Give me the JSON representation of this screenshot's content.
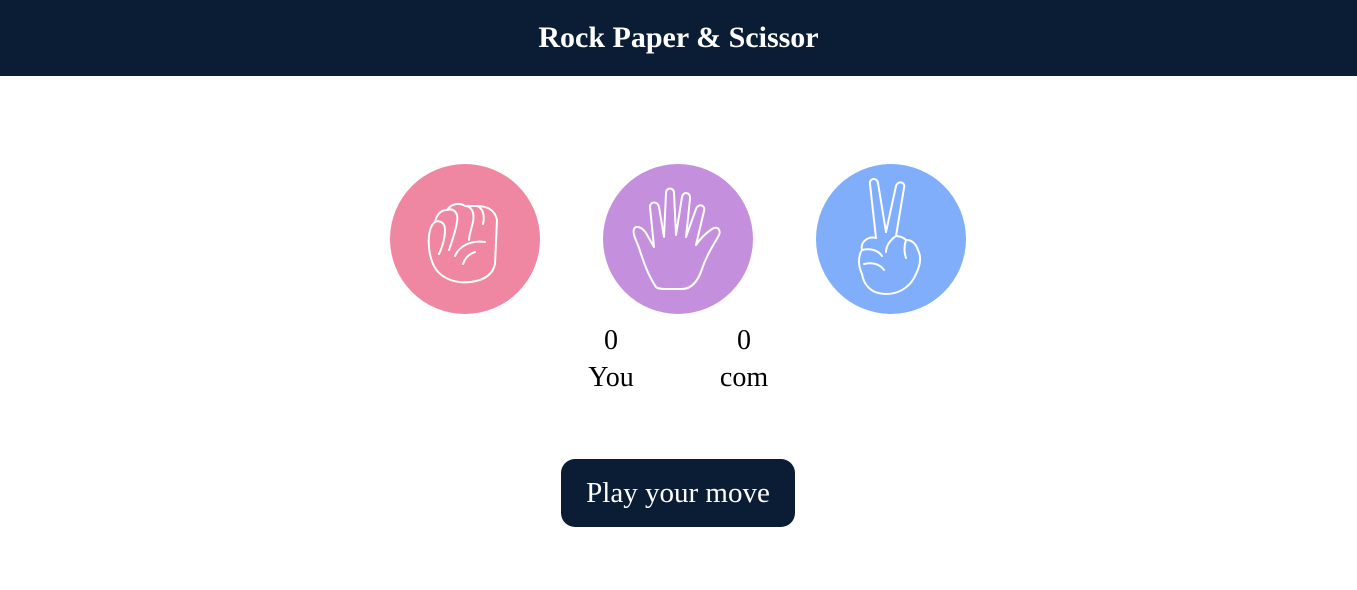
{
  "header": {
    "title": "Rock Paper & Scissor"
  },
  "choices": [
    {
      "id": "rock",
      "icon": "fist-icon",
      "color": "#ef86a2"
    },
    {
      "id": "paper",
      "icon": "open-hand-icon",
      "color": "#c490dd"
    },
    {
      "id": "scissor",
      "icon": "peace-hand-icon",
      "color": "#80aefa"
    }
  ],
  "scores": {
    "you": {
      "value": "0",
      "label": "You"
    },
    "com": {
      "value": "0",
      "label": "com"
    }
  },
  "action": {
    "play_label": "Play your move"
  },
  "colors": {
    "header_bg": "#0b1d35",
    "button_bg": "#0b1d35"
  }
}
